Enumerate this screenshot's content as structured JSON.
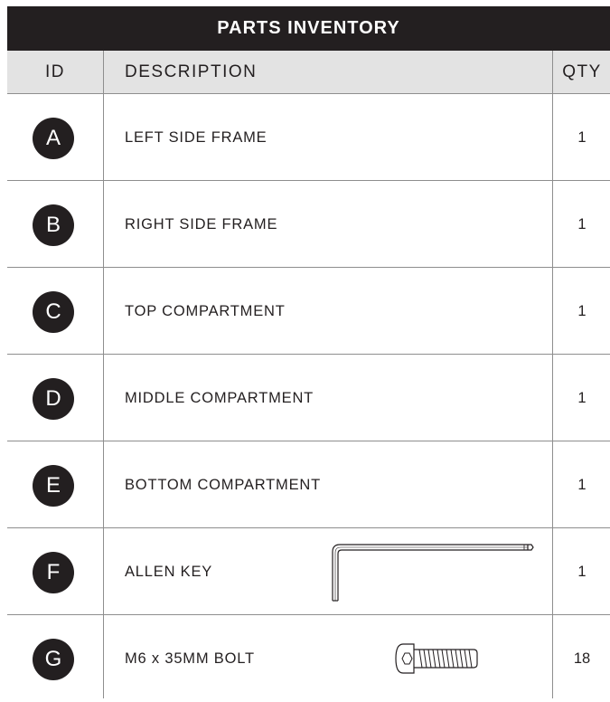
{
  "table": {
    "title": "PARTS INVENTORY",
    "headers": {
      "id": "ID",
      "description": "DESCRIPTION",
      "qty": "QTY"
    },
    "rows": [
      {
        "id": "A",
        "description": "LEFT SIDE FRAME",
        "qty": "1"
      },
      {
        "id": "B",
        "description": "RIGHT SIDE FRAME",
        "qty": "1"
      },
      {
        "id": "C",
        "description": "TOP COMPARTMENT",
        "qty": "1"
      },
      {
        "id": "D",
        "description": "MIDDLE COMPARTMENT",
        "qty": "1"
      },
      {
        "id": "E",
        "description": "BOTTOM COMPARTMENT",
        "qty": "1"
      },
      {
        "id": "F",
        "description": "ALLEN KEY",
        "qty": "1",
        "illustration": "allen-key-icon"
      },
      {
        "id": "G",
        "description": "M6 x 35MM BOLT",
        "qty": "18",
        "illustration": "bolt-icon"
      }
    ]
  },
  "colors": {
    "title_bg": "#231f20",
    "header_bg": "#e3e3e3",
    "rule": "#8e8e8e",
    "text": "#231f20"
  }
}
